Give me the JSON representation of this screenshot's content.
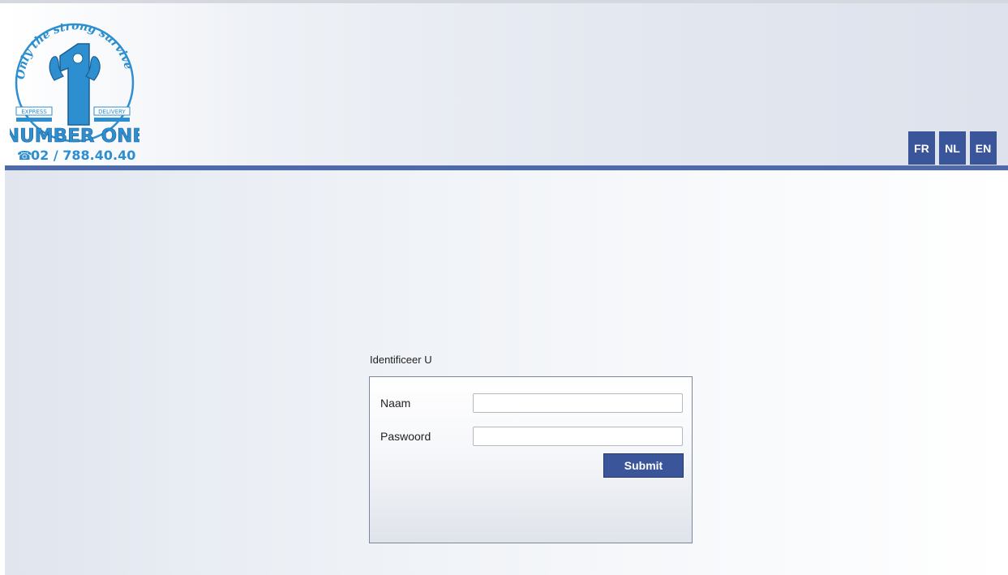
{
  "logo": {
    "slogan": "Only the strong survive !",
    "left_tag": "EXPRESS",
    "right_tag": "DELIVERY",
    "brand": "NUMBER ONE",
    "phone": "02 / 788.40.40"
  },
  "languages": [
    "FR",
    "NL",
    "EN"
  ],
  "login": {
    "title": "Identificeer U",
    "name_label": "Naam",
    "name_value": "",
    "password_label": "Paswoord",
    "password_value": "",
    "submit_label": "Submit"
  },
  "colors": {
    "accent": "#3b559a",
    "header_bar": "#4f6aa8",
    "logo_blue": "#2d8fd0"
  }
}
